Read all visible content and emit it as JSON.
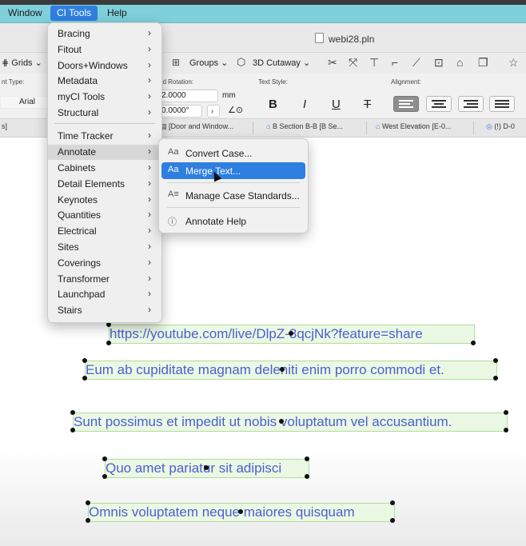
{
  "menubar": {
    "window": "Window",
    "ci_tools": "CI Tools",
    "help": "Help"
  },
  "document": {
    "title": "webi28.pln"
  },
  "toolbar": {
    "grids": "Grids",
    "groups": "Groups",
    "cutaway": "3D Cutaway"
  },
  "info": {
    "font_type_label": "nt Type:",
    "font_value": "Arial",
    "rotation_label": "nd Rotation:",
    "height_value": "2.0000",
    "height_unit": "mm",
    "angle_value": "0.0000°",
    "text_style_label": "Text Style:",
    "alignment_label": "Alignment:",
    "bold": "B",
    "italic": "I",
    "underline": "U",
    "strike": "T"
  },
  "tabs": [
    "s]",
    "[Door and Window...",
    "B Section B-B [B Se...",
    "West Elevation [E-0...",
    "(!) D-0"
  ],
  "ci_menu": {
    "items": [
      "Bracing",
      "Fitout",
      "Doors+Windows",
      "Metadata",
      "myCI Tools",
      "Structural",
      "Time Tracker",
      "Annotate",
      "Cabinets",
      "Detail Elements",
      "Keynotes",
      "Quantities",
      "Electrical",
      "Sites",
      "Coverings",
      "Transformer",
      "Launchpad",
      "Stairs"
    ]
  },
  "annotate_menu": {
    "items": [
      "Convert Case...",
      "Merge Text...",
      "Manage Case Standards...",
      "Annotate Help"
    ],
    "selected": "Merge Text..."
  },
  "canvas": {
    "lines": [
      "https://youtube.com/live/DlpZ-3qcjNk?feature=share",
      "Eum ab cupiditate magnam deleniti enim porro commodi et.",
      "Sunt possimus et impedit ut nobis voluptatum vel accusantium.",
      "Quo amet pariatur sit adipisci",
      "Omnis voluptatem neque maiores quisquam"
    ]
  },
  "colors": {
    "menubar": "#7fd0da",
    "selection": "#2f7fe0",
    "text": "#4c5fd2",
    "textbox_fill": "#ebf8e3"
  }
}
